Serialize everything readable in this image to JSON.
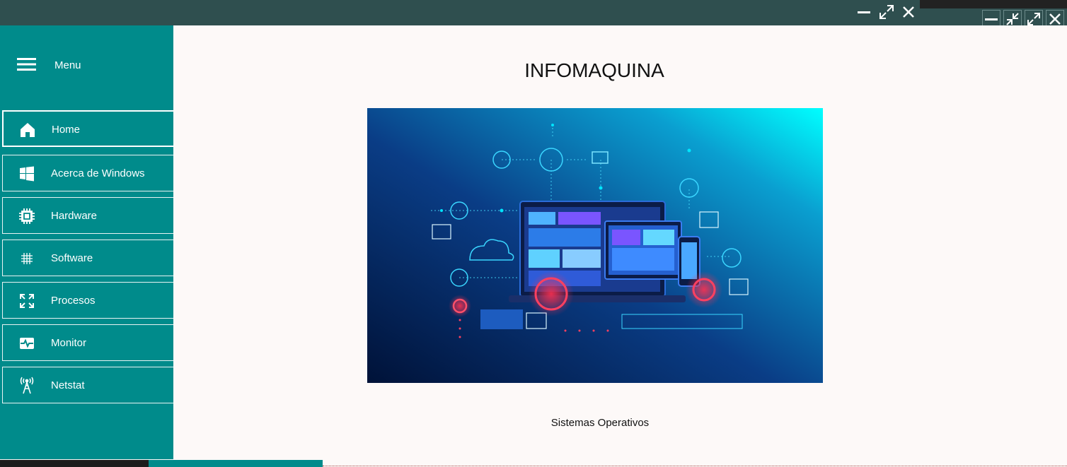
{
  "window": {
    "minimize_icon": "minimize-icon",
    "maximize_icon": "maximize-icon",
    "close_icon": "close-icon"
  },
  "right_controls": {
    "minimize_icon": "minimize-icon",
    "restore_icon": "restore-icon",
    "maximize_icon": "maximize-icon",
    "close_icon": "close-icon"
  },
  "sidebar": {
    "menu_label": "Menu",
    "menu_icon": "hamburger-icon",
    "items": [
      {
        "label": "Home",
        "icon": "home-icon"
      },
      {
        "label": "Acerca de Windows",
        "icon": "windows-icon"
      },
      {
        "label": "Hardware",
        "icon": "chip-icon"
      },
      {
        "label": "Software",
        "icon": "software-icon"
      },
      {
        "label": "Procesos",
        "icon": "processes-icon"
      },
      {
        "label": "Monitor",
        "icon": "monitor-icon"
      },
      {
        "label": "Netstat",
        "icon": "antenna-icon"
      }
    ],
    "active_index": 0
  },
  "main": {
    "title": "INFOMAQUINA",
    "caption": "Sistemas Operativos"
  },
  "colors": {
    "titlebar": "#2f4f4f",
    "sidebar": "#008b8b",
    "content_bg": "#fdf9f8",
    "hero_start": "#001a4d",
    "hero_end": "#00ffff"
  }
}
